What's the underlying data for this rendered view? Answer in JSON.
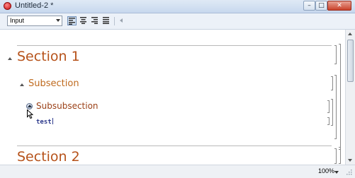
{
  "window": {
    "title": "Untitled-2 *",
    "controls": {
      "minimize": "–",
      "maximize": "□",
      "close": "✕"
    }
  },
  "toolbar": {
    "style_value": "Input",
    "buttons": [
      "align-left-icon",
      "align-center-icon",
      "align-right-icon",
      "justify-icon"
    ]
  },
  "notebook": {
    "section1": "Section 1",
    "subsection": "Subsection",
    "subsubsection": "Subsubsection",
    "input": "test",
    "section2": "Section 2"
  },
  "statusbar": {
    "zoom": "100%"
  }
}
